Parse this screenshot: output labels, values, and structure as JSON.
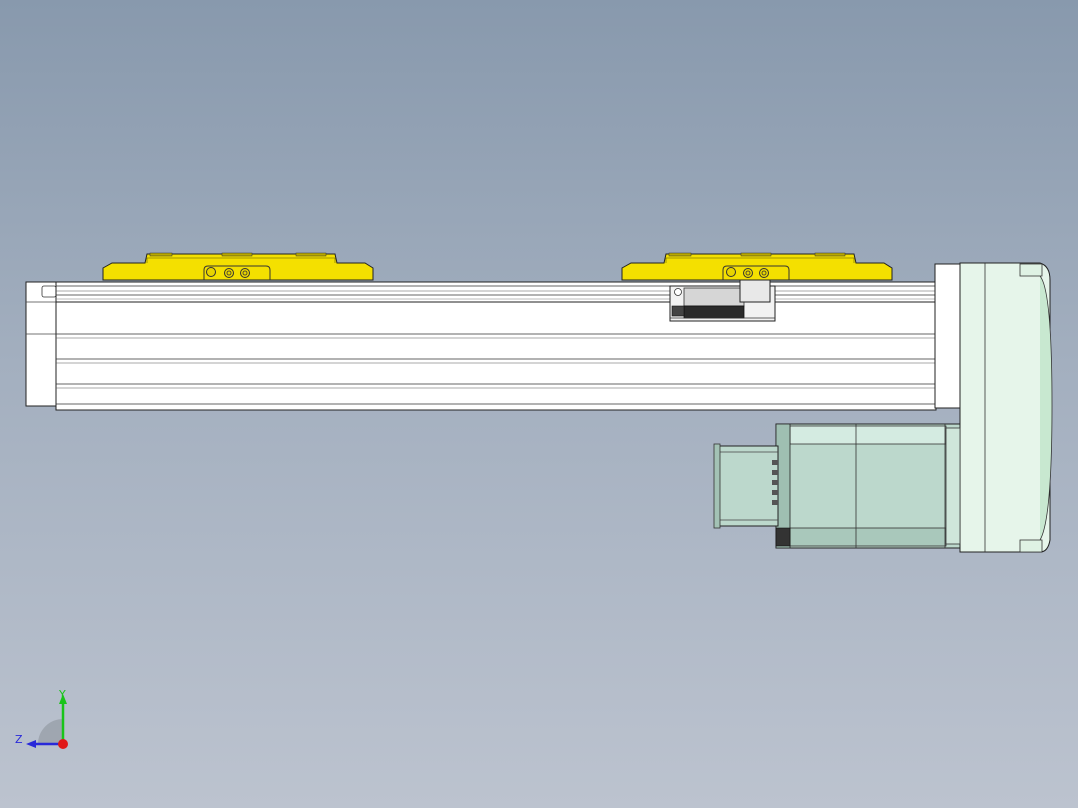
{
  "viewport": {
    "background_top": "#8899ad",
    "background_bottom": "#bcc3cf"
  },
  "model": {
    "carriage_color": "#f4e000",
    "rail_color": "#ffffff",
    "motor_color": "#bcd8cc",
    "edge_color": "#222222"
  },
  "triad": {
    "y_label": "Y",
    "z_label": "Z",
    "y_color": "#19c419",
    "z_color": "#2929d9",
    "x_color": "#e01818"
  }
}
